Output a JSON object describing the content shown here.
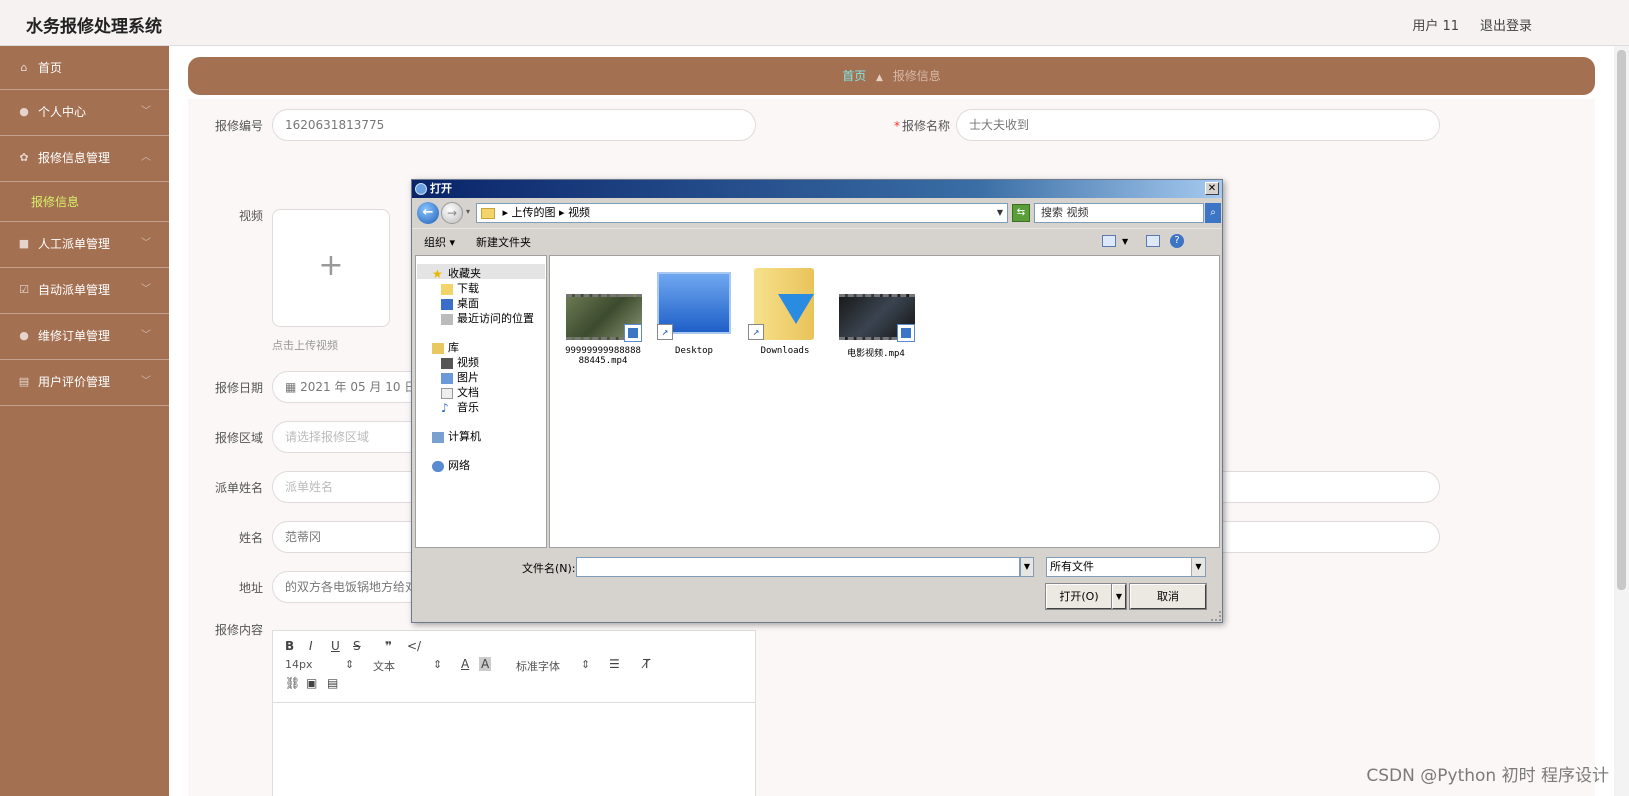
{
  "header": {
    "title": "水务报修处理系统",
    "user": "用户 11",
    "logout": "退出登录"
  },
  "sidebar": {
    "items": [
      {
        "label": "首页",
        "icon": "home-icon"
      },
      {
        "label": "个人中心",
        "icon": "user-icon"
      },
      {
        "label": "报修信息管理",
        "icon": "gear-icon"
      },
      {
        "label": "人工派单管理",
        "icon": "video-icon"
      },
      {
        "label": "自动派单管理",
        "icon": "check-icon"
      },
      {
        "label": "维修订单管理",
        "icon": "user-icon"
      },
      {
        "label": "用户评价管理",
        "icon": "doc-icon"
      }
    ],
    "sub_item": "报修信息"
  },
  "breadcrumb": {
    "home": "首页",
    "current": "报修信息"
  },
  "form": {
    "repair_no_label": "报修编号",
    "repair_no_value": "1620631813775",
    "repair_name_label": "报修名称",
    "repair_name_value": "士大夫收到",
    "video_label": "视频",
    "upload_hint": "点击上传视频",
    "date_label": "报修日期",
    "date_value": "2021 年 05 月 10 日",
    "area_label": "报修区域",
    "area_placeholder": "请选择报修区域",
    "dispatch_label": "派单姓名",
    "dispatch_placeholder": "派单姓名",
    "name_label": "姓名",
    "name_value": "范蒂冈",
    "address_label": "地址",
    "address_value": "的双方各电饭锅地方给对方",
    "content_label": "报修内容"
  },
  "editor": {
    "font_size": "14px",
    "text_style": "文本",
    "font_family": "标准字体"
  },
  "dialog": {
    "title": "打开",
    "path": [
      "上传的图",
      "视频"
    ],
    "search": "搜索 视频",
    "organize": "组织",
    "new_folder": "新建文件夹",
    "tree": {
      "favorites": "收藏夹",
      "downloads": "下载",
      "desktop": "桌面",
      "recent": "最近访问的位置",
      "library": "库",
      "videos": "视频",
      "pictures": "图片",
      "documents": "文档",
      "music": "音乐",
      "computer": "计算机",
      "network": "网络"
    },
    "files": [
      {
        "name": "9999999998888888445.mp4",
        "kind": "video"
      },
      {
        "name": "Desktop",
        "kind": "shortcut"
      },
      {
        "name": "Downloads",
        "kind": "folder"
      },
      {
        "name": "电影视频.mp4",
        "kind": "video"
      }
    ],
    "filename_label": "文件名(N):",
    "filename_value": "",
    "filetype": "所有文件",
    "open_button": "打开(O)",
    "cancel_button": "取消"
  },
  "watermark": "CSDN @Python 初时 程序设计",
  "colors": {
    "sidebar": "#a47052",
    "accent_green": "#d8f06a",
    "breadcrumb_home": "#7ee6e6",
    "required": "#e53935"
  }
}
